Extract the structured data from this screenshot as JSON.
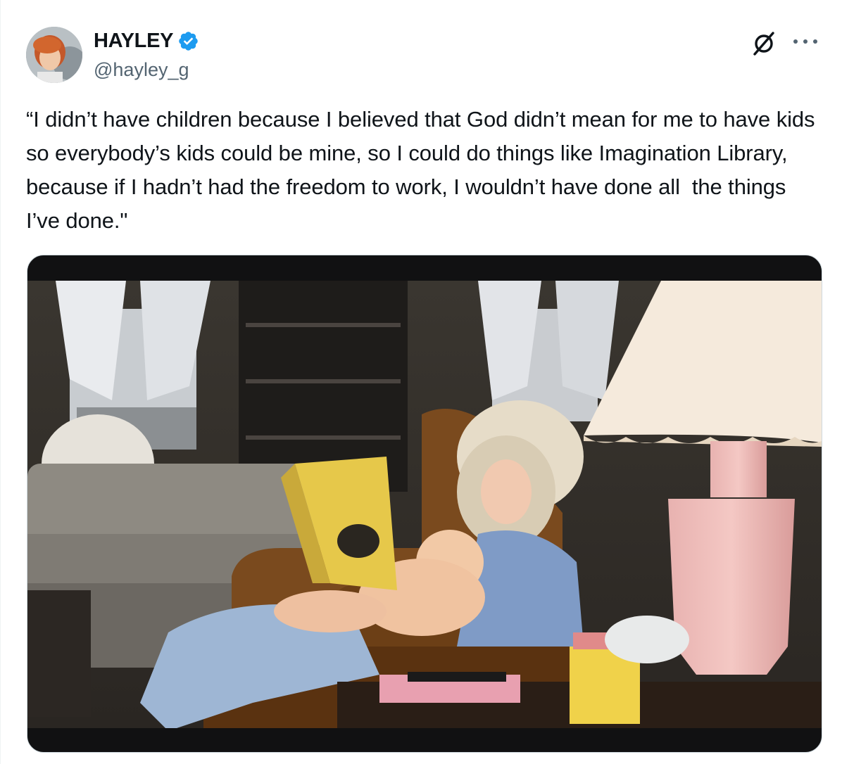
{
  "author": {
    "display_name": "HAYLEY",
    "handle": "@hayley_g",
    "verified": true
  },
  "tweet": {
    "text": "“I didn’t have children because I believed that God didn’t mean for me to have kids so everybody’s kids could be mine, so I could do things like Imagination Library,  because if I hadn’t had the freedom to work, I wouldn’t have done all  the things I’ve done.\""
  },
  "icons": {
    "verified": "verified-badge-icon",
    "grok": "grok-icon",
    "more": "more-options-icon"
  },
  "colors": {
    "verified_blue": "#1d9bf0",
    "text_primary": "#0f1419",
    "text_secondary": "#536471"
  }
}
